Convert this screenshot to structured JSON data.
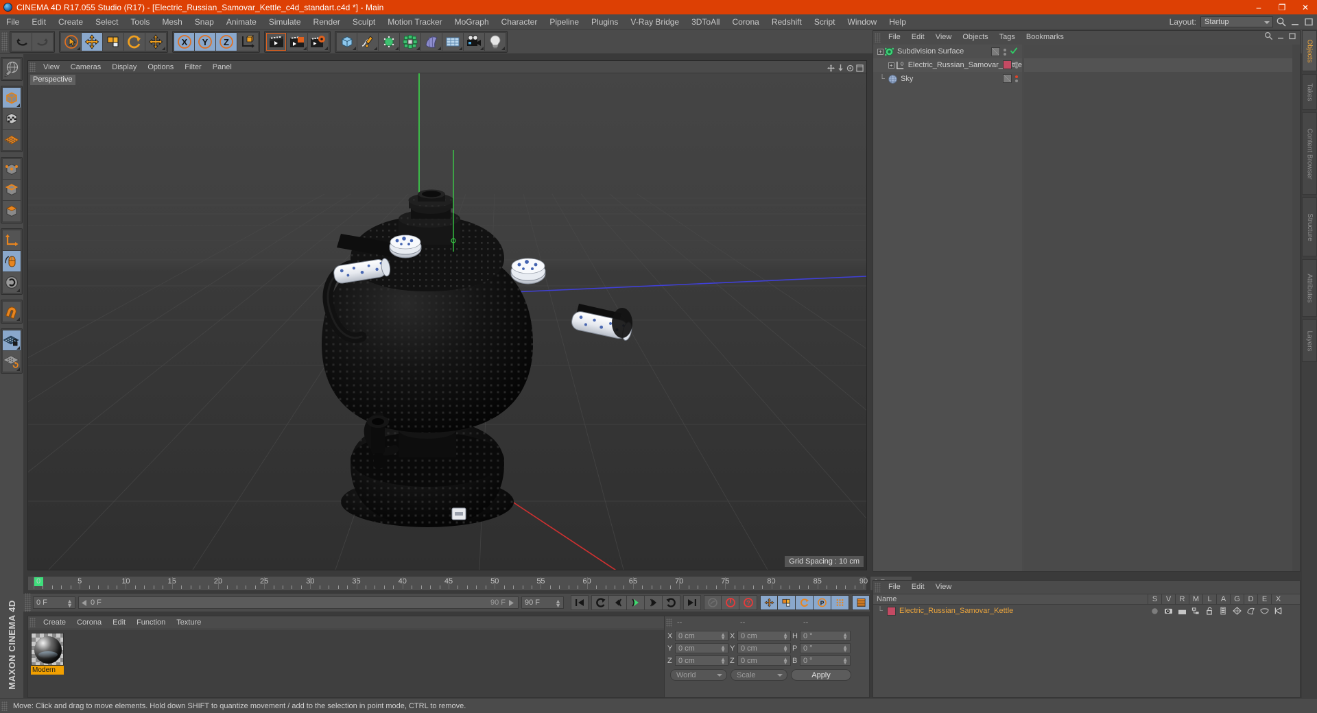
{
  "window": {
    "title": "CINEMA 4D R17.055 Studio (R17) - [Electric_Russian_Samovar_Kettle_c4d_standart.c4d *] - Main",
    "minimize": "–",
    "maximize": "❐",
    "close": "✕"
  },
  "menubar": {
    "items": [
      "File",
      "Edit",
      "Create",
      "Select",
      "Tools",
      "Mesh",
      "Snap",
      "Animate",
      "Simulate",
      "Render",
      "Sculpt",
      "Motion Tracker",
      "MoGraph",
      "Character",
      "Pipeline",
      "Plugins",
      "V-Ray Bridge",
      "3DToAll",
      "Corona",
      "Redshift",
      "Script",
      "Window",
      "Help"
    ],
    "layout_label": "Layout:",
    "layout_value": "Startup"
  },
  "viewport": {
    "menu": [
      "View",
      "Cameras",
      "Display",
      "Options",
      "Filter",
      "Panel"
    ],
    "label": "Perspective",
    "grid_spacing": "Grid Spacing : 10 cm",
    "axis_x": "X",
    "axis_y": "Y",
    "axis_z": "Z"
  },
  "timeline": {
    "ticks": [
      {
        "label": "0",
        "value": 0
      },
      {
        "label": "5",
        "value": 5
      },
      {
        "label": "10",
        "value": 10
      },
      {
        "label": "15",
        "value": 15
      },
      {
        "label": "20",
        "value": 20
      },
      {
        "label": "25",
        "value": 25
      },
      {
        "label": "30",
        "value": 30
      },
      {
        "label": "35",
        "value": 35
      },
      {
        "label": "40",
        "value": 40
      },
      {
        "label": "45",
        "value": 45
      },
      {
        "label": "50",
        "value": 50
      },
      {
        "label": "55",
        "value": 55
      },
      {
        "label": "60",
        "value": 60
      },
      {
        "label": "65",
        "value": 65
      },
      {
        "label": "70",
        "value": 70
      },
      {
        "label": "75",
        "value": 75
      },
      {
        "label": "80",
        "value": 80
      },
      {
        "label": "85",
        "value": 85
      },
      {
        "label": "90",
        "value": 90
      }
    ],
    "range_min": 0,
    "range_max": 90,
    "end_frame_box": "0 F",
    "current_frame": "0 F",
    "track_frame": "0 F",
    "preview_end": "90 F",
    "total_frames": "90 F"
  },
  "material_manager": {
    "menu": [
      "Create",
      "Corona",
      "Edit",
      "Function",
      "Texture"
    ],
    "materials": [
      {
        "name": "Modern"
      }
    ]
  },
  "coordinates": {
    "headers": [
      "--",
      "--",
      "--"
    ],
    "rows": [
      {
        "pos_label": "X",
        "pos_value": "0 cm",
        "size_label": "X",
        "size_value": "0 cm",
        "rot_label": "H",
        "rot_value": "0 °"
      },
      {
        "pos_label": "Y",
        "pos_value": "0 cm",
        "size_label": "Y",
        "size_value": "0 cm",
        "rot_label": "P",
        "rot_value": "0 °"
      },
      {
        "pos_label": "Z",
        "pos_value": "0 cm",
        "size_label": "Z",
        "size_value": "0 cm",
        "rot_label": "B",
        "rot_value": "0 °"
      }
    ],
    "system": "World",
    "mode": "Scale",
    "apply": "Apply"
  },
  "object_manager": {
    "menu": [
      "File",
      "Edit",
      "View",
      "Objects",
      "Tags",
      "Bookmarks"
    ],
    "objects": [
      {
        "name": "Subdivision Surface",
        "icon": "subdivision-surface-icon",
        "depth": 0,
        "expandable": true,
        "has_check": true
      },
      {
        "name": "Electric_Russian_Samovar_Kettle",
        "icon": "null-object-icon",
        "depth": 1,
        "expandable": true,
        "material_color": "#c44a63"
      },
      {
        "name": "Sky",
        "icon": "sky-icon",
        "depth": 0,
        "expandable": false,
        "has_red_dot": true
      }
    ]
  },
  "layer_manager": {
    "menu": [
      "File",
      "Edit",
      "View"
    ],
    "columns": [
      "Name",
      "S",
      "V",
      "R",
      "M",
      "L",
      "A",
      "G",
      "D",
      "E",
      "X"
    ],
    "rows": [
      {
        "name": "Electric_Russian_Samovar_Kettle",
        "color": "#c44a63"
      }
    ]
  },
  "right_tabs": [
    "Objects",
    "Takes",
    "Content Browser",
    "Structure",
    "Attributes",
    "Layers"
  ],
  "statusbar": {
    "message": "Move: Click and drag to move elements. Hold down SHIFT to quantize movement / add to the selection in point mode, CTRL to remove."
  },
  "branding": {
    "text": "MAXON CINEMA 4D"
  },
  "colors": {
    "title_bar": "#dd4004",
    "accent_orange": "#e8851f",
    "panel_bg": "#4b4b4b",
    "selected_blue": "#8aa8cc",
    "viewport_bg": "#3d3d3d",
    "material_label": "#f2a000",
    "axis_x": "#cc3333",
    "axis_y": "#33cc33",
    "axis_z": "#3333cc"
  },
  "toolbar": {
    "buttons": [
      {
        "name": "undo",
        "label": "Undo"
      },
      {
        "name": "redo",
        "label": "Redo"
      },
      {
        "name": "live-selection",
        "label": "Live Selection"
      },
      {
        "name": "move",
        "label": "Move"
      },
      {
        "name": "scale",
        "label": "Scale"
      },
      {
        "name": "rotate",
        "label": "Rotate"
      },
      {
        "name": "move-axis",
        "label": "Move Axis"
      },
      {
        "name": "lock-x",
        "label": "X"
      },
      {
        "name": "lock-y",
        "label": "Y"
      },
      {
        "name": "lock-z",
        "label": "Z"
      },
      {
        "name": "world-object-coord",
        "label": "World/Object Coordinate System"
      },
      {
        "name": "render-view",
        "label": "Render View"
      },
      {
        "name": "render-region",
        "label": "Render Region"
      },
      {
        "name": "render-settings",
        "label": "Render Settings"
      },
      {
        "name": "add-cube",
        "label": "Cube"
      },
      {
        "name": "add-spline",
        "label": "Spline"
      },
      {
        "name": "add-nurbs",
        "label": "NURBS"
      },
      {
        "name": "add-mograph",
        "label": "MoGraph"
      },
      {
        "name": "add-deformer",
        "label": "Deformer"
      },
      {
        "name": "add-environment",
        "label": "Environment"
      },
      {
        "name": "add-camera",
        "label": "Camera"
      },
      {
        "name": "add-light",
        "label": "Light"
      }
    ]
  },
  "left_toolbar": {
    "buttons": [
      {
        "name": "make-editable",
        "label": "Make Editable"
      },
      {
        "name": "model-mode",
        "label": "Model Mode"
      },
      {
        "name": "texture-mode",
        "label": "Texture Mode"
      },
      {
        "name": "workplane-mode",
        "label": "Workplane"
      },
      {
        "name": "point-mode",
        "label": "Points"
      },
      {
        "name": "edge-mode",
        "label": "Edges"
      },
      {
        "name": "polygon-mode",
        "label": "Polygons"
      },
      {
        "name": "axis-mode",
        "label": "Enable Axis Modification"
      },
      {
        "name": "viewport-solo",
        "label": "Viewport Solo"
      },
      {
        "name": "snap-settings",
        "label": "Enable Snapping"
      },
      {
        "name": "magnet-tool",
        "label": "Magnet"
      },
      {
        "name": "workplane-lock",
        "label": "Lock Workplane"
      },
      {
        "name": "workplane-align",
        "label": "Align Workplane"
      }
    ]
  },
  "playback": {
    "buttons": [
      {
        "name": "go-to-start",
        "label": "Go to Start"
      },
      {
        "name": "step-back-keyframe",
        "label": "Previous Keyframe"
      },
      {
        "name": "step-back-frame",
        "label": "Previous Frame"
      },
      {
        "name": "play",
        "label": "Play"
      },
      {
        "name": "step-forward-frame",
        "label": "Next Frame"
      },
      {
        "name": "step-forward-keyframe",
        "label": "Next Keyframe"
      },
      {
        "name": "go-to-end",
        "label": "Go to End"
      },
      {
        "name": "record-active-objects",
        "label": "Record Active Objects"
      },
      {
        "name": "autokeying",
        "label": "Autokeying"
      },
      {
        "name": "keyframe-selection",
        "label": "Keyframe Selection"
      },
      {
        "name": "position-key",
        "label": "Position"
      },
      {
        "name": "scale-key",
        "label": "Scale"
      },
      {
        "name": "rotation-key",
        "label": "Rotation"
      },
      {
        "name": "param-key",
        "label": "Parameter"
      },
      {
        "name": "point-level-anim",
        "label": "Point Level Animation"
      }
    ]
  }
}
